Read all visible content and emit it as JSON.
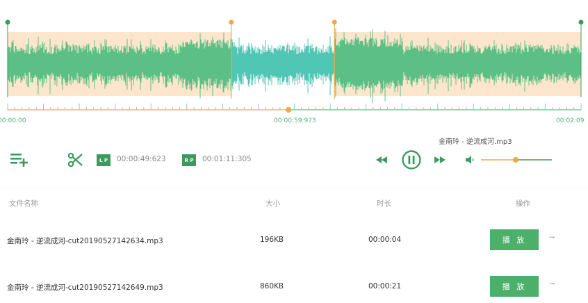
{
  "waveform": {
    "time_start": "00:00:00",
    "time_current": "00:00:59:973",
    "time_end": "00:02:09",
    "selection_start_fraction": 0.39,
    "selection_end_fraction": 0.57,
    "playhead_fraction": 0.49,
    "colors": {
      "wave": "#5cbf86",
      "wave_selected": "#4fc7b4",
      "outside_shade": "#fde6cc",
      "marker": "#f0a84a",
      "edge_marker": "#3d9a5f"
    }
  },
  "player": {
    "track_name": "金南玲 - 逆流成河.mp3",
    "lp_label": "L P",
    "rp_label": "R P",
    "lp_time": "00:00:49:623",
    "rp_time": "00:01:11:305",
    "volume_fraction": 0.49,
    "icons": [
      "playlist-add-icon",
      "scissors-icon",
      "rewind-icon",
      "pause-icon",
      "fast-forward-icon",
      "volume-icon"
    ]
  },
  "table": {
    "headers": {
      "name": "文件名称",
      "size": "大小",
      "duration": "时长",
      "actions": "操作"
    },
    "rows": [
      {
        "name": "金南玲 - 逆流成河-cut20190527142634.mp3",
        "size": "196KB",
        "duration": "00:00:04",
        "play": "播 放",
        "more": "···"
      },
      {
        "name": "金南玲 - 逆流成河-cut20190527142649.mp3",
        "size": "860KB",
        "duration": "00:00:21",
        "play": "播 放",
        "more": "···"
      }
    ]
  }
}
